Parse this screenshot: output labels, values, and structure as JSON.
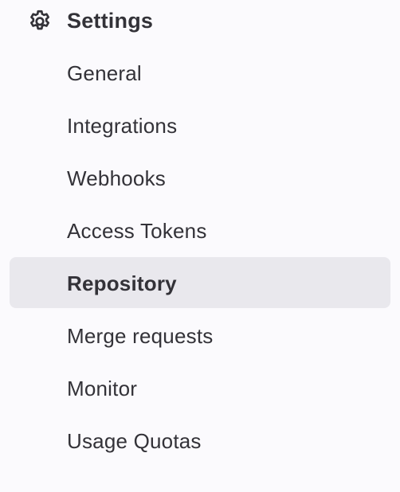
{
  "section": {
    "title": "Settings",
    "icon": "gear-icon"
  },
  "nav": {
    "items": [
      {
        "label": "General",
        "active": false
      },
      {
        "label": "Integrations",
        "active": false
      },
      {
        "label": "Webhooks",
        "active": false
      },
      {
        "label": "Access Tokens",
        "active": false
      },
      {
        "label": "Repository",
        "active": true
      },
      {
        "label": "Merge requests",
        "active": false
      },
      {
        "label": "Monitor",
        "active": false
      },
      {
        "label": "Usage Quotas",
        "active": false
      }
    ]
  },
  "colors": {
    "background": "#fbfafd",
    "active_background": "#e9e8ed",
    "text": "#333238"
  }
}
